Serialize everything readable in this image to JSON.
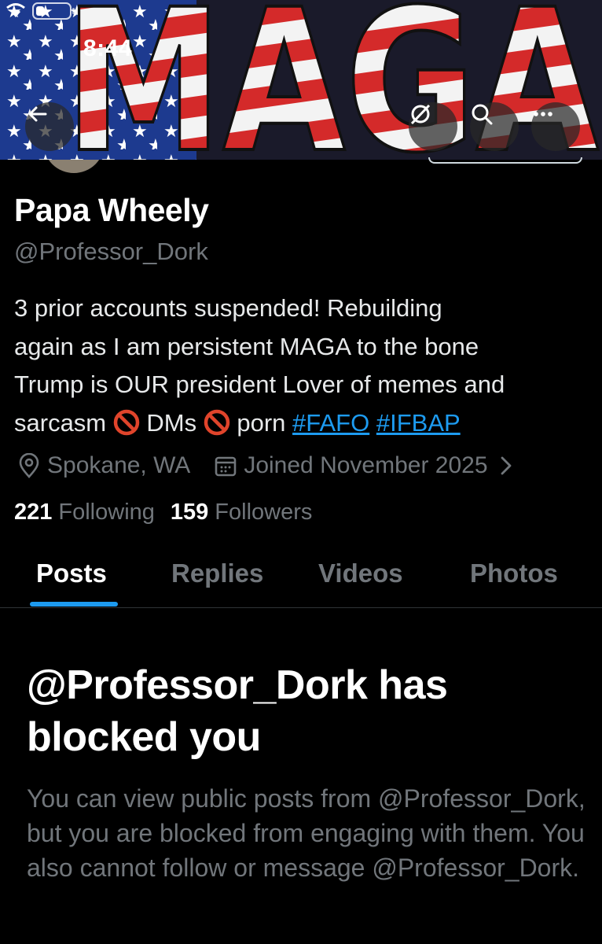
{
  "status_bar": {
    "time": "8:44"
  },
  "banner": {
    "text": "MAGA"
  },
  "header_buttons": {
    "back": "back-arrow-icon",
    "grok": "grok-icon",
    "search": "search-icon",
    "more": "more-icon"
  },
  "profile": {
    "display_name": "Papa Wheely",
    "handle": "@Professor_Dork",
    "bio": {
      "line1": "3 prior accounts suspended! Rebuilding",
      "line2": "again as I am persistent MAGA to the bone",
      "line3": "Trump is OUR president Lover of memes and",
      "line4_a": "sarcasm",
      "line4_b": "DMs",
      "line4_c": "porn",
      "hashtag1": "#FAFO",
      "hashtag2": "#IFBAP"
    },
    "location": "Spokane, WA",
    "joined": "Joined November 2025",
    "following_count": "221",
    "following_label": "Following",
    "followers_count": "159",
    "followers_label": "Followers"
  },
  "tabs": [
    "Posts",
    "Replies",
    "Videos",
    "Photos"
  ],
  "active_tab": "Posts",
  "blocked": {
    "title": "@Professor_Dork has blocked you",
    "body": "You can view public posts from @Professor_Dork, but you are blocked from engaging with them. You also cannot follow or message @Professor_Dork."
  },
  "colors": {
    "accent": "#1d9bf0",
    "background": "#000000",
    "muted": "#71767b"
  }
}
